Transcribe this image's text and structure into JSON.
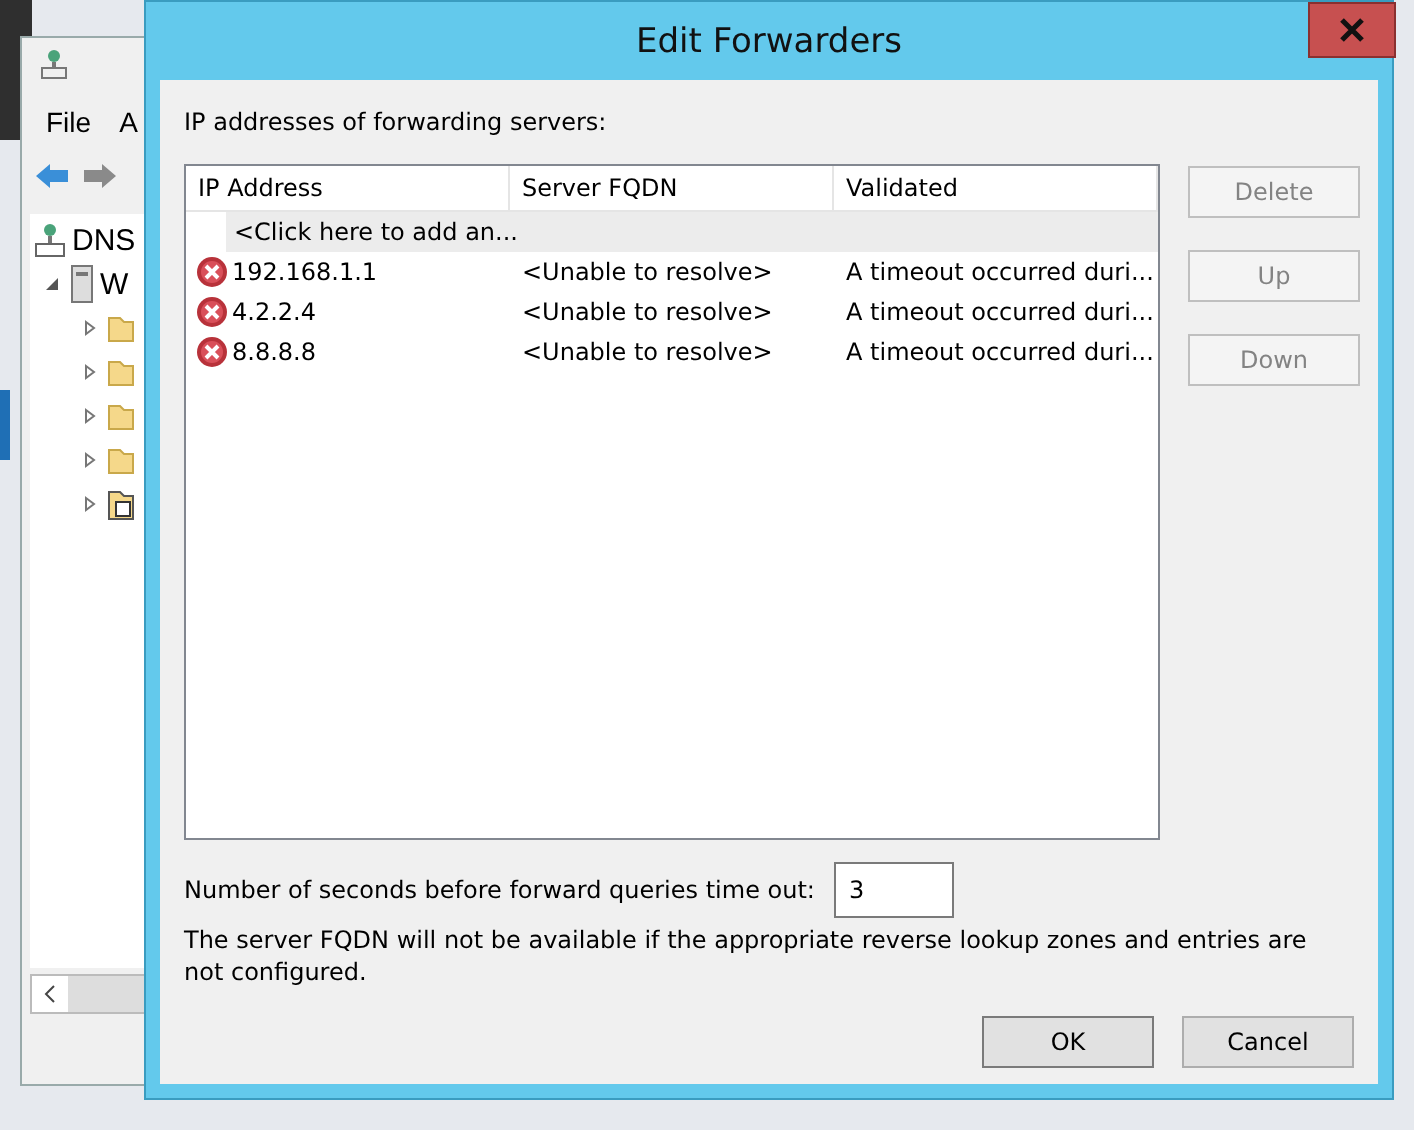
{
  "background_window": {
    "menu": [
      "File",
      "A"
    ],
    "tree": [
      {
        "label": "DNS",
        "kind": "dns",
        "children": [
          {
            "label": "W",
            "kind": "server",
            "expanded": true,
            "children": [
              {
                "kind": "folder",
                "expanded": false
              },
              {
                "kind": "folder",
                "expanded": false
              },
              {
                "kind": "folder",
                "expanded": false
              },
              {
                "kind": "folder",
                "expanded": false
              },
              {
                "kind": "zone-folder",
                "expanded": false
              }
            ]
          }
        ]
      }
    ]
  },
  "dialog": {
    "title": "Edit Forwarders",
    "list_label": "IP addresses of forwarding servers:",
    "table": {
      "columns": [
        "IP Address",
        "Server FQDN",
        "Validated"
      ],
      "add_row": "<Click here to add an...",
      "rows": [
        {
          "kind": "error",
          "ip": "192.168.1.1",
          "fqdn": "<Unable to resolve>",
          "validated": "A timeout occurred duri..."
        },
        {
          "kind": "error",
          "ip": "4.2.2.4",
          "fqdn": "<Unable to resolve>",
          "validated": "A timeout occurred duri..."
        },
        {
          "kind": "error",
          "ip": "8.8.8.8",
          "fqdn": "<Unable to resolve>",
          "validated": "A timeout occurred duri..."
        }
      ]
    },
    "side_buttons": [
      {
        "label": "Delete",
        "disabled": true
      },
      {
        "label": "Up",
        "disabled": true
      },
      {
        "label": "Down",
        "disabled": true
      }
    ],
    "timeout_label": "Number of seconds before forward queries time out:",
    "timeout_value": "3",
    "note": "The server FQDN will not be available if the appropriate reverse lookup zones and entries are not configured.",
    "buttons": [
      "OK",
      "Cancel"
    ]
  }
}
